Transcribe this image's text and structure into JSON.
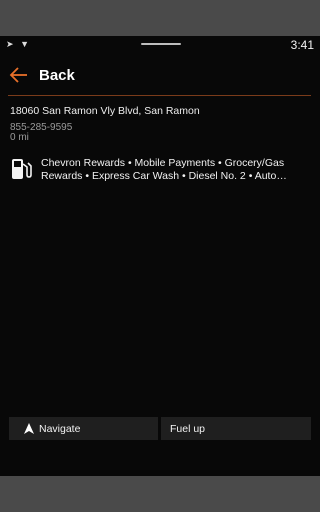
{
  "status_bar": {
    "time": "3:41",
    "icons": [
      "navigation-icon",
      "wifi-icon"
    ]
  },
  "header": {
    "back_label": "Back",
    "accent_color": "#e8702a"
  },
  "station": {
    "address": "18060 San Ramon Vly Blvd, San Ramon",
    "phone": "855-285-9595",
    "distance": "0 mi",
    "amenities": "Chevron Rewards • Mobile Payments • Grocery/Gas Rewards • Express Car Wash • Diesel No. 2 • Auto Services…"
  },
  "actions": {
    "navigate_label": "Navigate",
    "fuel_up_label": "Fuel up"
  }
}
